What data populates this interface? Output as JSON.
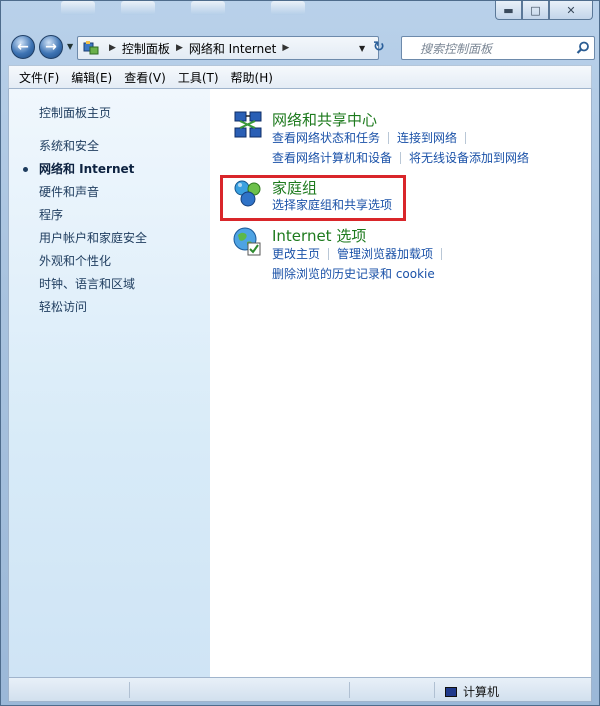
{
  "nav": {
    "breadcrumb": [
      "控制面板",
      "网络和 Internet"
    ],
    "search_placeholder": "搜索控制面板"
  },
  "menubar": {
    "items": [
      "文件(F)",
      "编辑(E)",
      "查看(V)",
      "工具(T)",
      "帮助(H)"
    ]
  },
  "sidebar": {
    "items": [
      {
        "label": "控制面板主页",
        "active": false
      },
      {
        "label": "系统和安全",
        "active": false
      },
      {
        "label": "网络和 Internet",
        "active": true
      },
      {
        "label": "硬件和声音",
        "active": false
      },
      {
        "label": "程序",
        "active": false
      },
      {
        "label": "用户帐户和家庭安全",
        "active": false
      },
      {
        "label": "外观和个性化",
        "active": false
      },
      {
        "label": "时钟、语言和区域",
        "active": false
      },
      {
        "label": "轻松访问",
        "active": false
      }
    ]
  },
  "sections": [
    {
      "icon": "network-sharing-icon",
      "title": "网络和共享中心",
      "links": [
        [
          "查看网络状态和任务",
          "连接到网络"
        ],
        [
          "查看网络计算机和设备",
          "将无线设备添加到网络"
        ]
      ]
    },
    {
      "icon": "homegroup-icon",
      "title": "家庭组",
      "links": [
        [
          "选择家庭组和共享选项"
        ]
      ],
      "highlighted": true
    },
    {
      "icon": "internet-options-icon",
      "title": "Internet 选项",
      "links": [
        [
          "更改主页",
          "管理浏览器加载项"
        ],
        [
          "删除浏览的历史记录和 cookie"
        ]
      ]
    }
  ],
  "statusbar": {
    "computer_label": "计算机"
  },
  "colors": {
    "highlight": "#d9262a",
    "section_title": "#1d7a1d",
    "link": "#1b52a8"
  }
}
